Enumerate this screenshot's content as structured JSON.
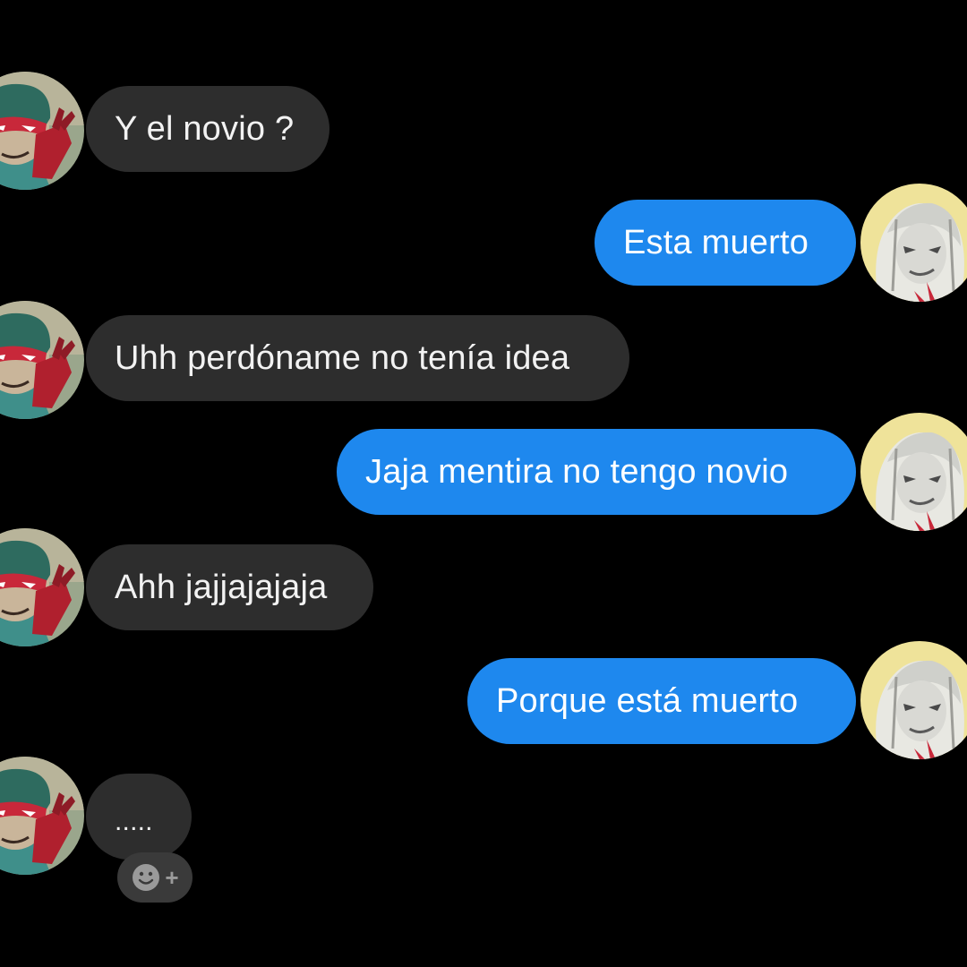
{
  "colors": {
    "background": "#000000",
    "incoming_bubble": "#2d2d2d",
    "outgoing_bubble": "#1e88ee",
    "text": "#ffffff"
  },
  "messages": [
    {
      "direction": "incoming",
      "text": "Y el novio ?",
      "avatar": "masked-hero-avatar"
    },
    {
      "direction": "outgoing",
      "text": "Esta muerto",
      "avatar": "pale-character-avatar"
    },
    {
      "direction": "incoming",
      "text": "Uhh perdóname no tenía idea",
      "avatar": "masked-hero-avatar"
    },
    {
      "direction": "outgoing",
      "text": "Jaja mentira no tengo novio",
      "avatar": "pale-character-avatar"
    },
    {
      "direction": "incoming",
      "text": "Ahh jajjajajaja",
      "avatar": "masked-hero-avatar"
    },
    {
      "direction": "outgoing",
      "text": "Porque está muerto",
      "avatar": "pale-character-avatar"
    },
    {
      "direction": "incoming",
      "text": ".....",
      "avatar": "masked-hero-avatar"
    }
  ],
  "reaction_button": {
    "icon": "smiley-add-icon",
    "plus": "+"
  }
}
